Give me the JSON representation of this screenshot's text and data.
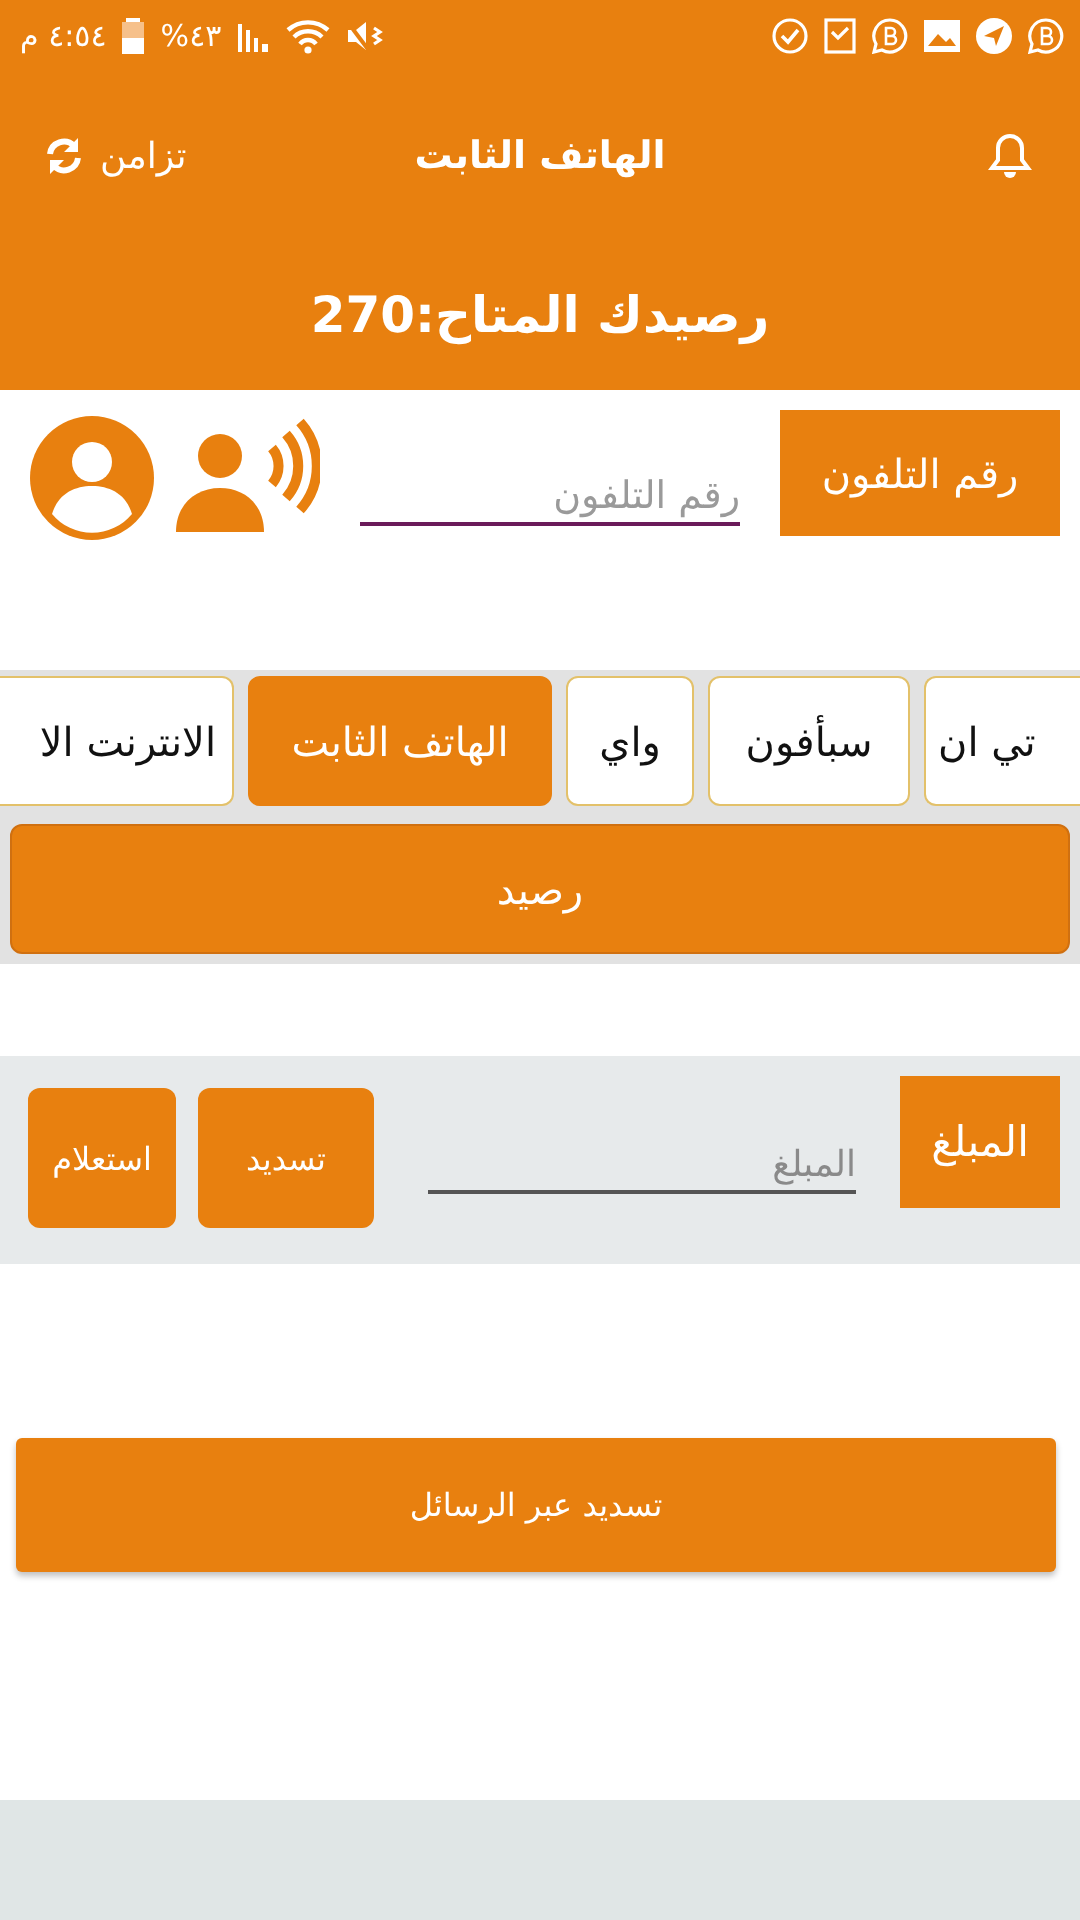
{
  "status_bar": {
    "time": "٤:٥٤ م",
    "battery": "%٤٣"
  },
  "toolbar": {
    "sync": "تزامن",
    "title": "الهاتف الثابت"
  },
  "balance": "رصيدك المتاح:270",
  "phone": {
    "label": "رقم التلفون",
    "placeholder": "رقم التلفون"
  },
  "providers": [
    {
      "label": "تي ان",
      "selected": false
    },
    {
      "label": "سبأفون",
      "selected": false
    },
    {
      "label": "واي",
      "selected": false
    },
    {
      "label": "الهاتف الثابت",
      "selected": true
    },
    {
      "label": "الانترنت الا",
      "selected": false
    }
  ],
  "balance_button": "رصيد",
  "amount": {
    "label": "المبلغ",
    "placeholder": "المبلغ",
    "pay": "تسديد",
    "inquiry": "استعلام"
  },
  "sms_button": "تسديد عبر الرسائل"
}
